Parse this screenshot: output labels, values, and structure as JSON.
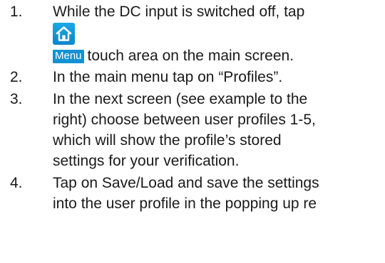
{
  "steps": [
    {
      "number": "1.",
      "text_before_icon": "While the DC input is switched off, tap",
      "icon": "home-icon",
      "icon_caption": "Menu",
      "text_after_icon": "touch area on the main screen."
    },
    {
      "number": "2.",
      "text": "In the main menu tap on “Profiles”."
    },
    {
      "number": "3.",
      "lines": [
        "In the next screen (see example to the",
        "right) choose between user profiles 1-5,",
        "which will show the profile’s stored",
        "settings for your verification."
      ]
    },
    {
      "number": "4.",
      "lines": [
        "Tap on Save/Load and save the settings",
        "into the user profile in the popping up re"
      ]
    }
  ],
  "colors": {
    "icon_background": "#0a9ad9",
    "menu_label_background": "#1392d3",
    "text": "#1a1a1a"
  }
}
